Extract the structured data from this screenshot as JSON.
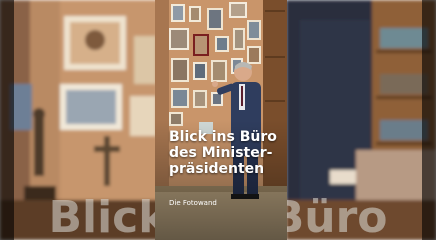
{
  "video": {
    "title_lines": [
      "Blick ins Büro",
      "des Minister-",
      "präsidenten"
    ],
    "subtitle": "Die Fotowand",
    "background_caption": "Blick ins Büro"
  },
  "colors": {
    "wall": "#c9956a",
    "wood": "#7a4e2c",
    "suit": "#2f3d5e",
    "floor": "#b6a07d"
  }
}
